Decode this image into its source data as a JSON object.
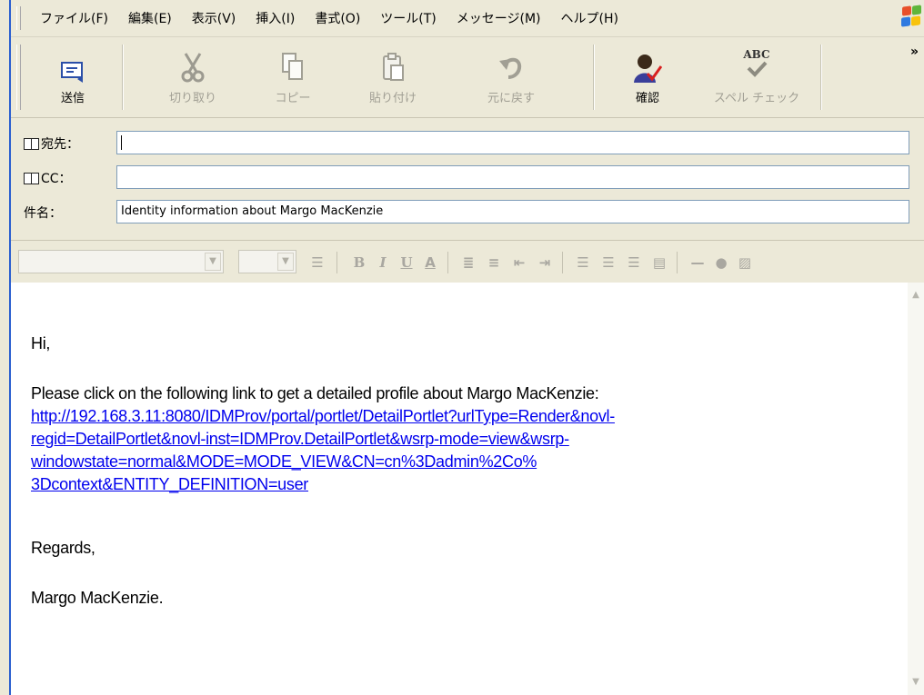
{
  "menu": [
    "ファイル(F)",
    "編集(E)",
    "表示(V)",
    "挿入(I)",
    "書式(O)",
    "ツール(T)",
    "メッセージ(M)",
    "ヘルプ(H)"
  ],
  "toolbar": {
    "send": "送信",
    "cut": "切り取り",
    "copy": "コピー",
    "paste": "貼り付け",
    "undo": "元に戻す",
    "check": "確認",
    "spell": "スペル チェック",
    "spell_icon_text": "ABC",
    "more": "»"
  },
  "fields": {
    "to_label": "宛先：",
    "cc_label": "CC：",
    "subject_label": "件名：",
    "to_value": "",
    "cc_value": "",
    "subject_value": "Identity information about Margo MacKenzie"
  },
  "body": {
    "greeting": "Hi,",
    "intro": "Please click on the following link to get a detailed profile about Margo MacKenzie:",
    "link_lines": [
      "http://192.168.3.11:8080/IDMProv/portal/portlet/DetailPortlet?urlType=Render&novl-",
      "regid=DetailPortlet&novl-inst=IDMProv.DetailPortlet&wsrp-mode=view&wsrp-",
      "windowstate=normal&MODE=MODE_VIEW&CN=cn%3Dadmin%2Co%",
      "3Dcontext&ENTITY_DEFINITION=user"
    ],
    "closing": "Regards,",
    "signature": "Margo MacKenzie."
  },
  "colors": {
    "accent": "#2a5fd0",
    "link": "#0000ee",
    "chrome": "#ece9d8",
    "field_border": "#7f9db9"
  }
}
